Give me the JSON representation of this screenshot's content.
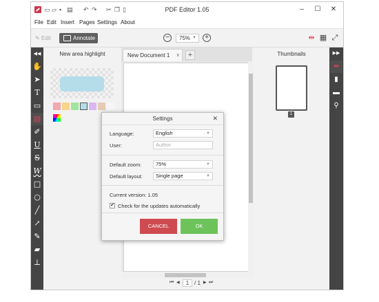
{
  "app": {
    "title": "PDF Editor 1.05",
    "quick_access": [
      "new-file-icon",
      "open-folder-icon",
      "save-icon",
      "print-icon",
      "undo-icon",
      "redo-icon",
      "cut-icon",
      "copy-icon",
      "paste-icon"
    ]
  },
  "window_controls": {
    "minimize": "–",
    "maximize": "☐",
    "close": "✕"
  },
  "menu": [
    "File",
    "Edit",
    "Insert",
    "Pages",
    "Settings",
    "About"
  ],
  "toolbar": {
    "edit_label": "Edit",
    "annotate_label": "Annotate",
    "zoom_value": "75%",
    "zoom_out": "−",
    "zoom_in": "+"
  },
  "left_tools": [
    "hand-tool-icon",
    "select-arrow-icon",
    "text-tool-icon",
    "comment-icon",
    "highlight-area-icon",
    "highlighter-pen-icon",
    "underline-icon",
    "strikethrough-icon",
    "squiggly-underline-icon",
    "rectangle-icon",
    "ellipse-icon",
    "line-icon",
    "arrow-icon",
    "pencil-icon",
    "eraser-icon",
    "stamp-icon"
  ],
  "left_panel": {
    "title": "New area highlight",
    "highlight_color": "#b4dce9",
    "swatches": [
      "#f2a8b0",
      "#f7d48a",
      "#9fe59b",
      "#b4dce9",
      "#d7b8f0",
      "#e5cbb4",
      "#f6f6f6"
    ]
  },
  "document": {
    "tab_label": "New Document 1",
    "tab_close": "x",
    "add_tab": "+"
  },
  "page_nav": {
    "current_page": "1",
    "total_pages": "/ 1",
    "first": "⏮",
    "prev": "◀",
    "next": "▶",
    "last": "⏭"
  },
  "thumbnails": {
    "title": "Thumbnails",
    "items": [
      {
        "label": "1"
      }
    ]
  },
  "right_tools": [
    "highlight-panel-icon",
    "bookmark-icon",
    "comment-list-icon",
    "search-icon"
  ],
  "dialog": {
    "title": "Settings",
    "close": "✕",
    "language_label": "Language:",
    "language_value": "English",
    "user_label": "User:",
    "user_placeholder": "Author",
    "zoom_label": "Default zoom:",
    "zoom_value": "75%",
    "layout_label": "Default layout:",
    "layout_value": "Single page",
    "version_text": "Current version: 1.05",
    "updates_label": "Check for the updates automatically",
    "updates_checked": "✔",
    "cancel_label": "CANCEL",
    "ok_label": "OK"
  }
}
